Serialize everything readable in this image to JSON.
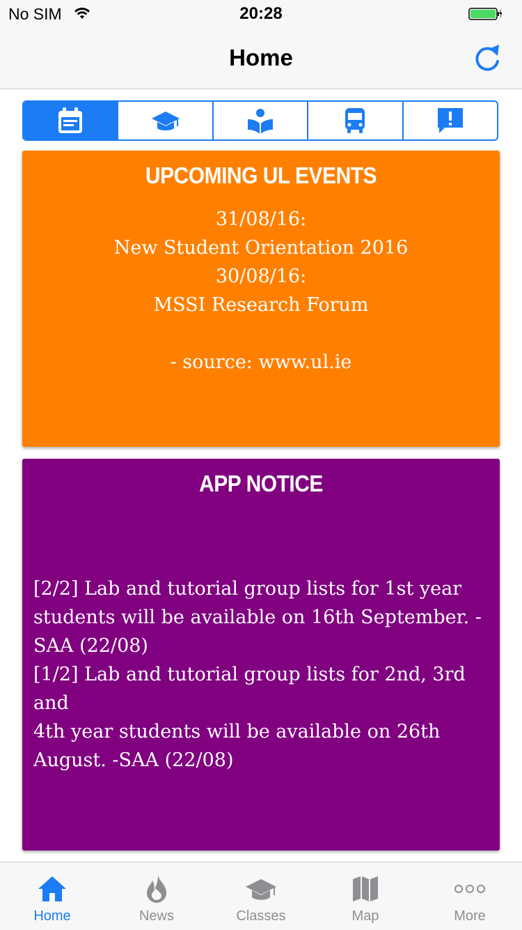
{
  "status_bar": {
    "carrier": "No SIM",
    "time": "20:28",
    "wifi_icon": "wifi-icon",
    "battery_icon": "battery-charging-icon"
  },
  "nav": {
    "title": "Home",
    "refresh_icon": "refresh-icon"
  },
  "segments": [
    {
      "icon": "calendar-icon",
      "active": true
    },
    {
      "icon": "graduation-cap-icon",
      "active": false
    },
    {
      "icon": "reader-book-icon",
      "active": false
    },
    {
      "icon": "bus-icon",
      "active": false
    },
    {
      "icon": "alert-message-icon",
      "active": false
    }
  ],
  "events_card": {
    "title": "UPCOMING UL EVENTS",
    "lines": [
      "31/08/16:",
      "New Student Orientation 2016",
      "30/08/16:",
      "MSSI Research Forum"
    ],
    "source": "- source: www.ul.ie",
    "color": "#ff8000"
  },
  "notice_card": {
    "title": "APP NOTICE",
    "lines": [
      "[2/2] Lab and tutorial group lists for 1st year",
      "students will be available on 16th September. -",
      "SAA (22/08)",
      "[1/2] Lab and tutorial group lists for 2nd, 3rd and",
      "4th year students will be available on 26th",
      "August. -SAA (22/08)"
    ],
    "color": "#800080"
  },
  "tabs": [
    {
      "label": "Home",
      "icon": "home-icon",
      "active": true
    },
    {
      "label": "News",
      "icon": "flame-icon",
      "active": false
    },
    {
      "label": "Classes",
      "icon": "graduation-cap-icon",
      "active": false
    },
    {
      "label": "Map",
      "icon": "map-icon",
      "active": false
    },
    {
      "label": "More",
      "icon": "more-dots-icon",
      "active": false
    }
  ],
  "colors": {
    "accent": "#1c7cf4",
    "inactive_tab": "#8e8e93"
  }
}
